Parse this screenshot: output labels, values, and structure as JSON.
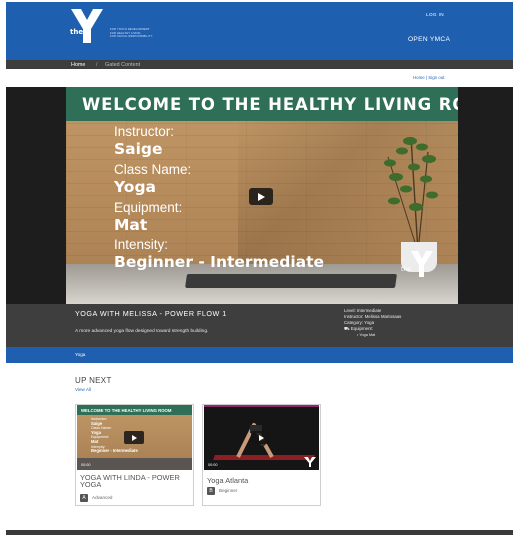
{
  "header": {
    "logo_prefix": "the",
    "tagline": [
      "FOR YOUTH DEVELOPMENT",
      "FOR HEALTHY LIVING",
      "FOR SOCIAL RESPONSIBILITY"
    ],
    "login_label": "LOG IN",
    "open_ymca_label": "OPEN YMCA",
    "brand_color": "#1f5fb0"
  },
  "breadcrumb": {
    "home": "Home",
    "separator": "/",
    "current": "Gated Content"
  },
  "user_links": "Home | Sign out",
  "video": {
    "banner": "WELCOME TO THE HEALTHY LIVING ROOM",
    "fields": [
      {
        "label": "Instructor:",
        "value": "Saige"
      },
      {
        "label": "Class Name:",
        "value": "Yoga"
      },
      {
        "label": "Equipment:",
        "value": "Mat"
      },
      {
        "label": "Intensity:",
        "value": "Beginner - Intermediate"
      }
    ],
    "watermark_text": "the",
    "play_icon": "play-icon"
  },
  "details": {
    "title": "YOGA WITH MELISSA - POWER FLOW 1",
    "description": "A more advanced yoga flow designed toward strength building.",
    "level": "Level: Intermediate",
    "instructor": "Instructor: Melissa Martosaas",
    "category": "Category: Yoga",
    "equipment_label": "Equipment:",
    "equipment_item": "• Yoga Mat"
  },
  "tag": "Yoga",
  "up_next": {
    "heading": "UP NEXT",
    "view_all": "View All",
    "cards": [
      {
        "title": "YOGA WITH LINDA - POWER YOGA",
        "level": "Advanced",
        "badge": "A",
        "thumb_banner": "WELCOME TO THE HEALTHY LIVING ROOM",
        "thumb_fields": [
          "Instructor:",
          "Saige",
          "Class Name:",
          "Yoga",
          "Equipment:",
          "Mat",
          "Intensity:",
          "Beginner - Intermediate"
        ],
        "timestamp": "00:00"
      },
      {
        "title": "Yoga Atlanta",
        "level": "Beginner",
        "badge": "B",
        "timestamp": "00:00"
      }
    ]
  }
}
